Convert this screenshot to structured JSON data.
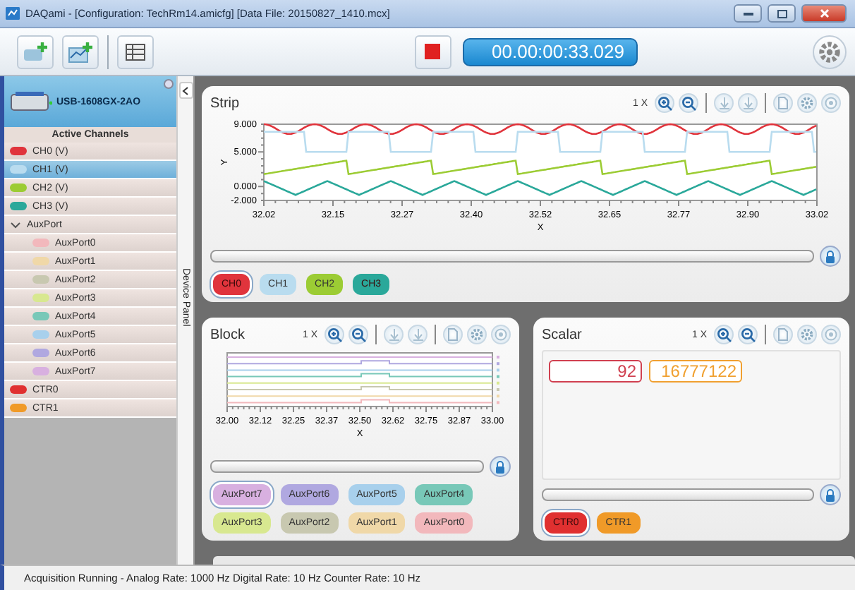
{
  "window": {
    "title": "DAQami - [Configuration: TechRm14.amicfg] [Data File: 20150827_1410.mcx]"
  },
  "toolbar": {
    "timer": "00.00:00:33.029",
    "running": true
  },
  "sidebar": {
    "device": "USB-1608GX-2AO",
    "channels_header": "Active Channels",
    "device_panel_label": "Device Panel",
    "items": [
      {
        "kind": "channel",
        "label": "CH0 (V)",
        "color": "#e0343c",
        "selected": false
      },
      {
        "kind": "channel",
        "label": "CH1 (V)",
        "color": "#b9dcef",
        "selected": true
      },
      {
        "kind": "channel",
        "label": "CH2 (V)",
        "color": "#9ccc34",
        "selected": false
      },
      {
        "kind": "channel",
        "label": "CH3 (V)",
        "color": "#2aa89a",
        "selected": false
      },
      {
        "kind": "group",
        "label": "AuxPort",
        "expanded": true,
        "children": [
          {
            "kind": "channel",
            "label": "AuxPort0",
            "color": "#f2b8bc",
            "selected": false
          },
          {
            "kind": "channel",
            "label": "AuxPort1",
            "color": "#f0d8a8",
            "selected": false
          },
          {
            "kind": "channel",
            "label": "AuxPort2",
            "color": "#c8c8b0",
            "selected": false
          },
          {
            "kind": "channel",
            "label": "AuxPort3",
            "color": "#d8e890",
            "selected": false
          },
          {
            "kind": "channel",
            "label": "AuxPort4",
            "color": "#78c8b8",
            "selected": false
          },
          {
            "kind": "channel",
            "label": "AuxPort5",
            "color": "#a8d0ec",
            "selected": false
          },
          {
            "kind": "channel",
            "label": "AuxPort6",
            "color": "#b0a8e0",
            "selected": false
          },
          {
            "kind": "channel",
            "label": "AuxPort7",
            "color": "#d8b0e0",
            "selected": false
          }
        ]
      },
      {
        "kind": "channel",
        "label": "CTR0",
        "color": "#e03030",
        "selected": false
      },
      {
        "kind": "channel",
        "label": "CTR1",
        "color": "#f09a28",
        "selected": false
      }
    ]
  },
  "panels": [
    {
      "kind": "plot",
      "title": "Strip",
      "zoom": "1 X",
      "cursor_tools": true,
      "plot": {
        "kind": "strip",
        "y_label": "Y",
        "x_label": "X",
        "y_ticks": [
          "9.000",
          "5.000",
          "0.000",
          "-2.000"
        ],
        "x_ticks": [
          "32.02",
          "32.15",
          "32.27",
          "32.40",
          "32.52",
          "32.65",
          "32.77",
          "32.90",
          "33.02"
        ]
      },
      "legend": [
        {
          "label": "CH0",
          "color": "#e0343c",
          "selected": true
        },
        {
          "label": "CH1",
          "color": "#b9dcef",
          "selected": false
        },
        {
          "label": "CH2",
          "color": "#9ccc34",
          "selected": false
        },
        {
          "label": "CH3",
          "color": "#2aa89a",
          "selected": false
        }
      ]
    },
    {
      "kind": "plot",
      "title": "Block",
      "zoom": "1 X",
      "cursor_tools": true,
      "plot": {
        "kind": "block",
        "x_label": "X",
        "x_ticks": [
          "32.00",
          "32.12",
          "32.25",
          "32.37",
          "32.50",
          "32.62",
          "32.75",
          "32.87",
          "33.00"
        ]
      },
      "legend": [
        {
          "label": "AuxPort7",
          "color": "#d8b0e0",
          "selected": true
        },
        {
          "label": "AuxPort6",
          "color": "#b0a8e0",
          "selected": false
        },
        {
          "label": "AuxPort5",
          "color": "#a8d0ec",
          "selected": false
        },
        {
          "label": "AuxPort4",
          "color": "#78c8b8",
          "selected": false
        },
        {
          "label": "AuxPort3",
          "color": "#d8e890",
          "selected": false
        },
        {
          "label": "AuxPort2",
          "color": "#c8c8b0",
          "selected": false
        },
        {
          "label": "AuxPort1",
          "color": "#f0d8a8",
          "selected": false
        },
        {
          "label": "AuxPort0",
          "color": "#f2b8bc",
          "selected": false
        }
      ]
    },
    {
      "kind": "scalar",
      "title": "Scalar",
      "zoom": "1 X",
      "cursor_tools": false,
      "readouts": [
        {
          "value": "92",
          "color": "#d04050"
        },
        {
          "value": "16777122",
          "color": "#f0a030"
        }
      ],
      "legend": [
        {
          "label": "CTR0",
          "color": "#e03030",
          "selected": true
        },
        {
          "label": "CTR1",
          "color": "#f09a28",
          "selected": false
        }
      ]
    }
  ],
  "status_bar": "Acquisition Running - Analog Rate: 1000 Hz Digital Rate: 10 Hz Counter Rate: 10 Hz"
}
